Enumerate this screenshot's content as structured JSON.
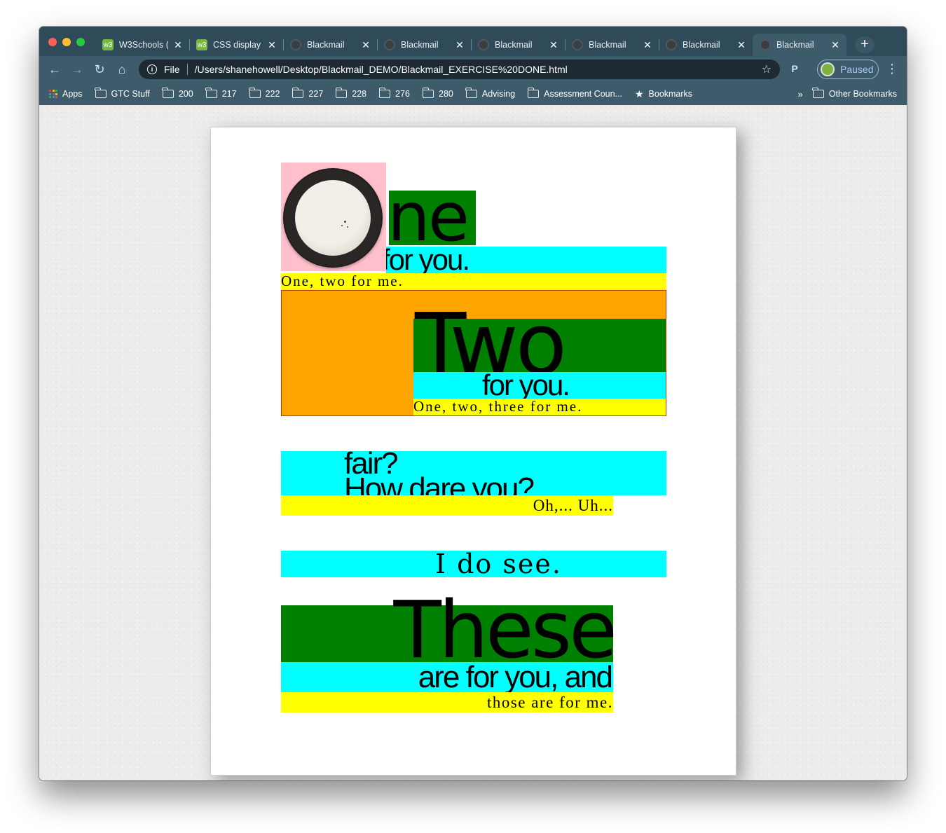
{
  "browser": {
    "tabs": [
      {
        "label": "W3Schools (",
        "favicon": "w3schools-icon"
      },
      {
        "label": "CSS display",
        "favicon": "w3schools-icon"
      },
      {
        "label": "Blackmail",
        "favicon": "globe-icon"
      },
      {
        "label": "Blackmail",
        "favicon": "globe-icon"
      },
      {
        "label": "Blackmail",
        "favicon": "globe-icon"
      },
      {
        "label": "Blackmail",
        "favicon": "globe-icon"
      },
      {
        "label": "Blackmail",
        "favicon": "globe-icon"
      },
      {
        "label": "Blackmail",
        "favicon": "globe-icon",
        "active": true
      }
    ],
    "omnibox": {
      "scheme": "File",
      "url": "/Users/shanehowell/Desktop/Blackmail_DEMO/Blackmail_EXERCISE%20DONE.html"
    },
    "profile_status": "Paused",
    "bookmarks": [
      {
        "label": "Apps",
        "icon": "apps-grid-icon"
      },
      {
        "label": "GTC Stuff",
        "icon": "folder-icon"
      },
      {
        "label": "200",
        "icon": "folder-icon"
      },
      {
        "label": "217",
        "icon": "folder-icon"
      },
      {
        "label": "222",
        "icon": "folder-icon"
      },
      {
        "label": "227",
        "icon": "folder-icon"
      },
      {
        "label": "228",
        "icon": "folder-icon"
      },
      {
        "label": "276",
        "icon": "folder-icon"
      },
      {
        "label": "280",
        "icon": "folder-icon"
      },
      {
        "label": "Advising",
        "icon": "folder-icon"
      },
      {
        "label": "Assessment Coun...",
        "icon": "folder-icon"
      },
      {
        "label": "Bookmarks",
        "icon": "star-icon"
      }
    ],
    "other_bookmarks": "Other Bookmarks",
    "colors": {
      "chrome": "#3d5b6b",
      "tabstrip": "#2f4a58",
      "omnibox": "#1d2a32"
    }
  },
  "poem": {
    "one": {
      "big": "ne",
      "for_you": "for you.",
      "count": "One, two for me."
    },
    "two": {
      "big": "Two",
      "for_you": "for you.",
      "count": "One, two, three for me."
    },
    "fair": {
      "line1": "fair?",
      "line2": "How dare you?",
      "reply": "Oh,... Uh..."
    },
    "see": {
      "text": "I do see."
    },
    "these": {
      "big": "These",
      "line2": "are for you, and",
      "line3": "those are for me."
    },
    "colors": {
      "pink": "#ffc0cb",
      "green": "#008000",
      "cyan": "#00ffff",
      "yellow": "#ffff00",
      "orange": "#ffa500"
    }
  }
}
